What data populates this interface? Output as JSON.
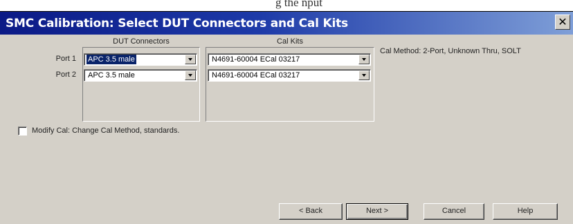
{
  "background_window": {
    "title_fragment": "g the nput"
  },
  "dialog": {
    "title": "SMC Calibration: Select DUT Connectors and Cal Kits",
    "close_label": "✕"
  },
  "dut_connectors": {
    "heading": "DUT Connectors",
    "ports": [
      {
        "label": "Port 1",
        "value": "APC 3.5 male",
        "selected": true
      },
      {
        "label": "Port 2",
        "value": "APC 3.5 male",
        "selected": false
      }
    ]
  },
  "cal_kits": {
    "heading": "Cal Kits",
    "ports": [
      {
        "value": "N4691-60004 ECal 03217"
      },
      {
        "value": "N4691-60004 ECal 03217"
      }
    ]
  },
  "cal_method_text": "Cal Method:  2-Port, Unknown Thru, SOLT",
  "modify_cal": {
    "label": "Modify Cal: Change Cal Method, standards.",
    "checked": false
  },
  "buttons": {
    "back": "< Back",
    "next": "Next >",
    "cancel": "Cancel",
    "help": "Help"
  },
  "colors": {
    "title_gradient_start": "#0b1a86",
    "title_gradient_end": "#7f9fd8",
    "dialog_face": "#d4d0c8",
    "selection": "#0a246a"
  }
}
